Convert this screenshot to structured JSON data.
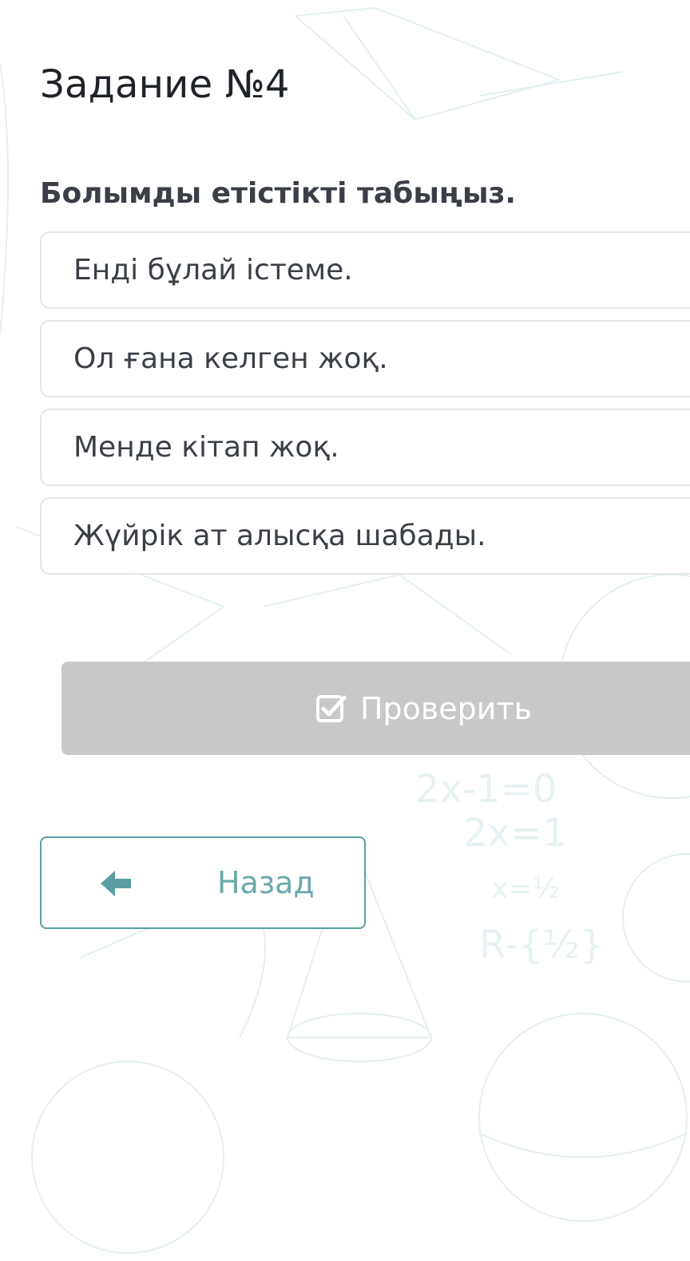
{
  "task": {
    "title": "Задание №4"
  },
  "question": {
    "text": "Болымды етістікті табыңыз."
  },
  "options": [
    {
      "label": "Енді бұлай істеме."
    },
    {
      "label": "Ол ғана келген жоқ."
    },
    {
      "label": "Менде кітап жоқ."
    },
    {
      "label": "Жүйрік ат алысқа шабады."
    }
  ],
  "actions": {
    "check_label": "Проверить",
    "check_icon": "checkbox-checked-icon",
    "back_label": "Назад",
    "back_icon": "arrow-left-icon"
  },
  "colors": {
    "check_button_bg": "#c8c8c8",
    "back_button_border": "#5a9ea3",
    "back_button_text": "#6aa8ab",
    "option_border": "#e4e6e9",
    "background_decor": "#e6f1f3"
  }
}
